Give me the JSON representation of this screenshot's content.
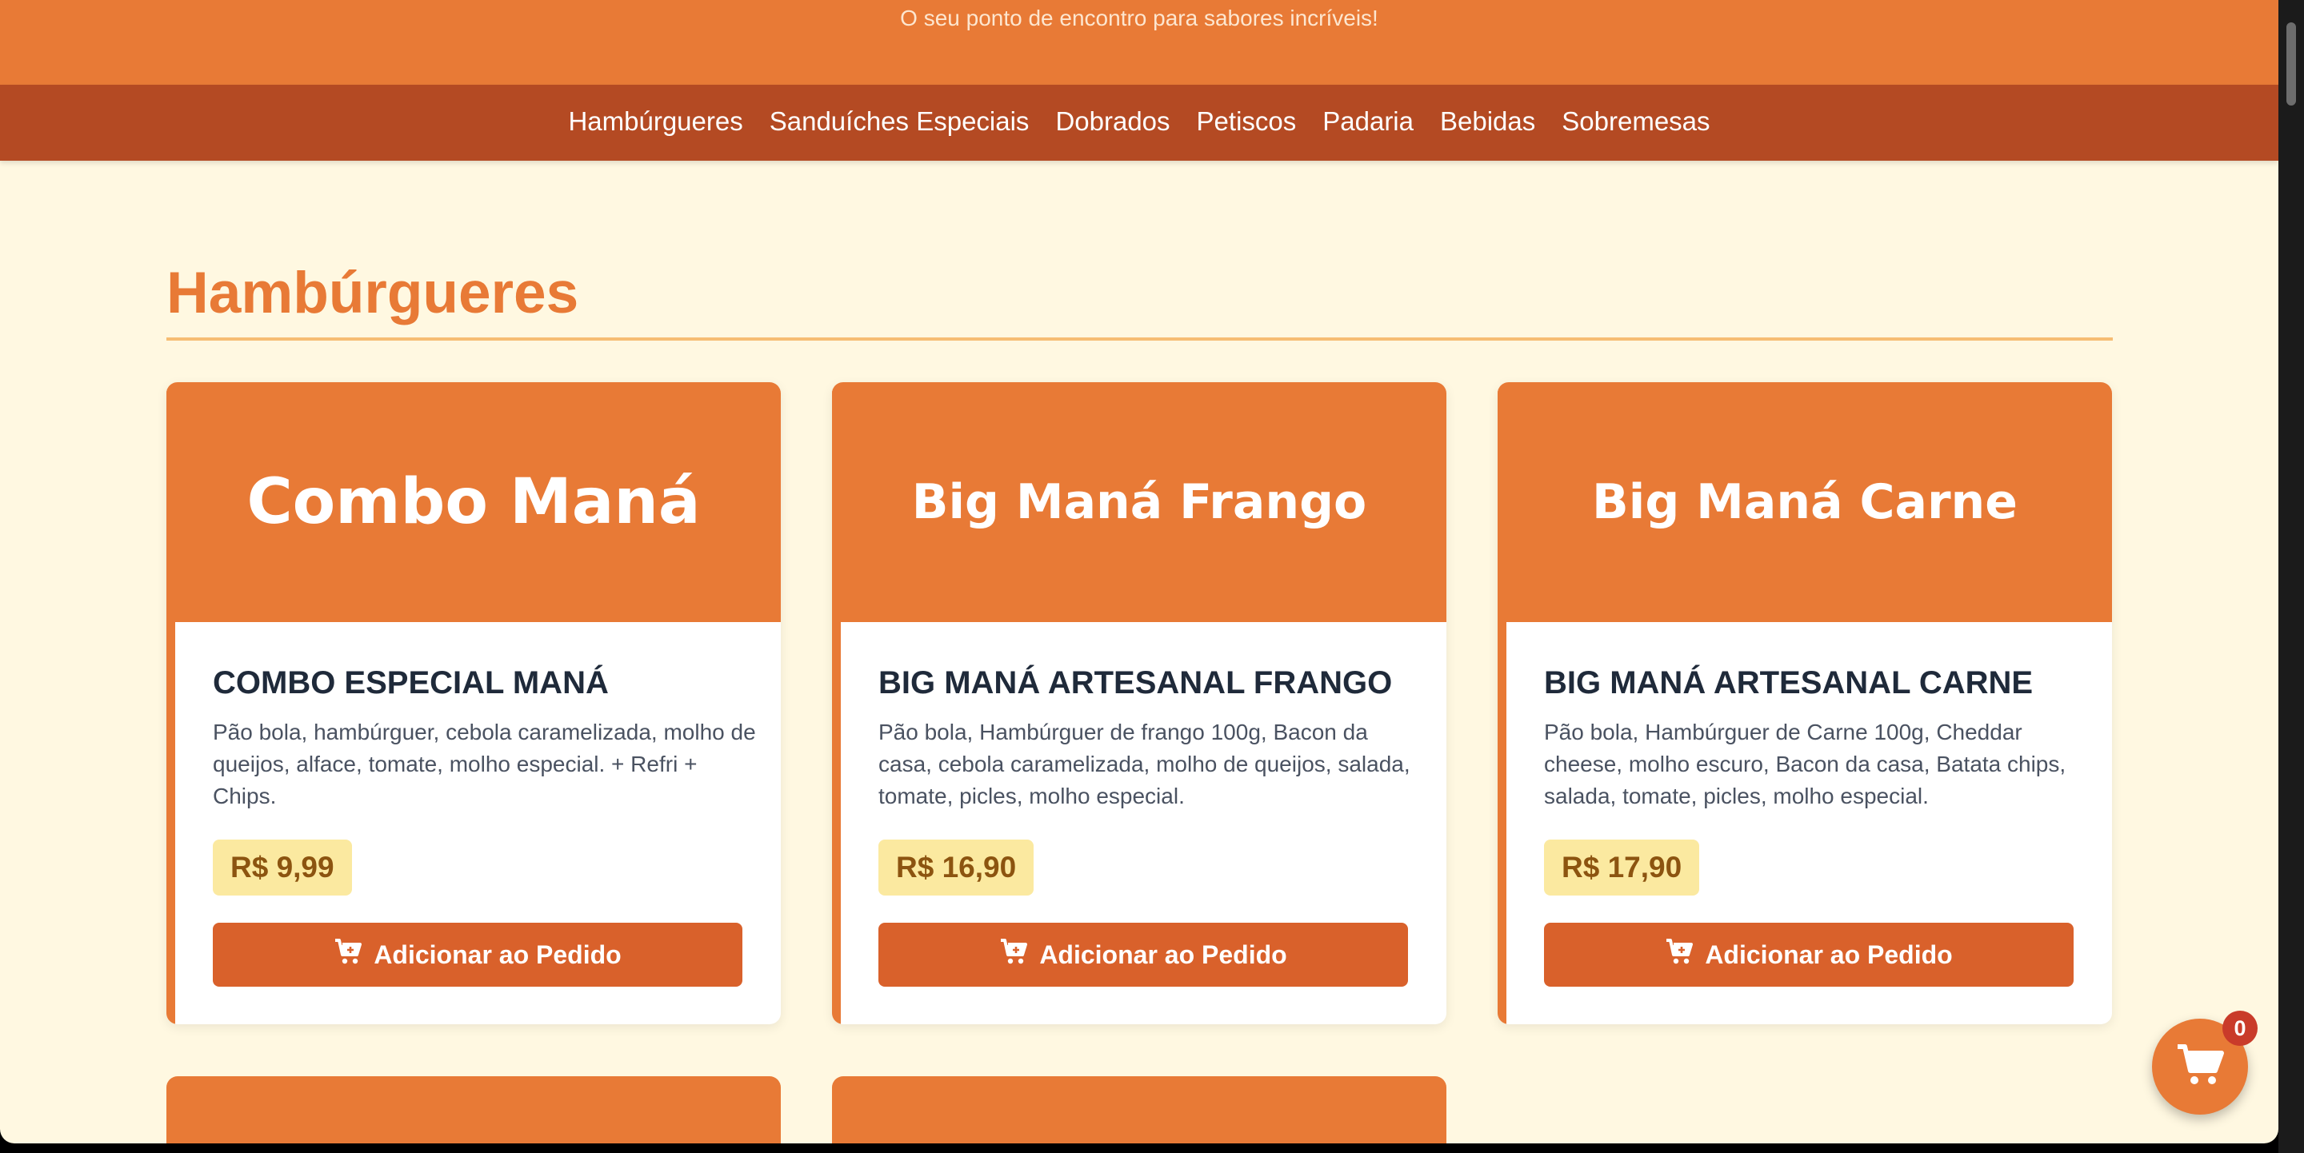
{
  "header": {
    "tagline": "O seu ponto de encontro para sabores incríveis!"
  },
  "nav": {
    "items": [
      "Hambúrgueres",
      "Sanduíches Especiais",
      "Dobrados",
      "Petiscos",
      "Padaria",
      "Bebidas",
      "Sobremesas"
    ]
  },
  "section": {
    "title": "Hambúrgueres"
  },
  "products": [
    {
      "header_text": "Combo Maná",
      "name": "COMBO ESPECIAL MANÁ",
      "description": "Pão bola, hambúrguer, cebola caramelizada, molho de queijos, alface, tomate, molho especial. + Refri + Chips.",
      "price": "R$ 9,99",
      "button_label": "Adicionar ao Pedido"
    },
    {
      "header_text": "Big Maná Frango",
      "name": "BIG MANÁ ARTESANAL FRANGO",
      "description": "Pão bola, Hambúrguer de frango 100g, Bacon da casa, cebola caramelizada, molho de queijos, salada, tomate, picles, molho especial.",
      "price": "R$ 16,90",
      "button_label": "Adicionar ao Pedido"
    },
    {
      "header_text": "Big Maná Carne",
      "name": "BIG MANÁ ARTESANAL CARNE",
      "description": "Pão bola, Hambúrguer de Carne 100g, Cheddar cheese, molho escuro, Bacon da casa, Batata chips, salada, tomate, picles, molho especial.",
      "price": "R$ 17,90",
      "button_label": "Adicionar ao Pedido"
    }
  ],
  "cart": {
    "count": "0",
    "icon": "cart-icon"
  },
  "colors": {
    "primary": "#e87a36",
    "nav": "#b44a23",
    "button": "#d9612b",
    "background": "#fff8e1",
    "price_badge": "#fbe9a0",
    "cart_badge": "#c93b2a"
  }
}
